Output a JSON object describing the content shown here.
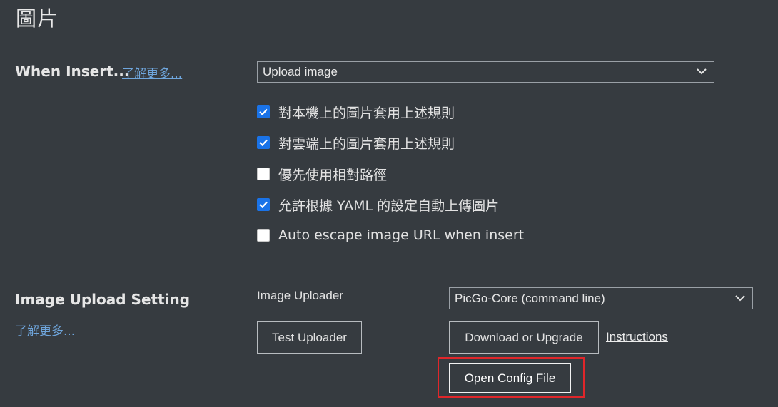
{
  "page": {
    "title": "圖片"
  },
  "when_insert": {
    "label": "When Insert...",
    "learn_more": "了解更多...",
    "select_value": "Upload image",
    "options": [
      {
        "label": "對本機上的圖片套用上述規則",
        "checked": true
      },
      {
        "label": "對雲端上的圖片套用上述規則",
        "checked": true
      },
      {
        "label": "優先使用相對路徑",
        "checked": false
      },
      {
        "label": "允許根據 YAML 的設定自動上傳圖片",
        "checked": true
      },
      {
        "label": "Auto escape image URL when insert",
        "checked": false
      }
    ]
  },
  "upload_setting": {
    "label": "Image Upload Setting",
    "learn_more": "了解更多...",
    "uploader_label": "Image Uploader",
    "uploader_value": "PicGo-Core (command line)",
    "test_button": "Test Uploader",
    "download_button": "Download or Upgrade",
    "instructions_link": "Instructions",
    "open_config_button": "Open Config File"
  },
  "colors": {
    "background": "#363b40",
    "checkbox_accent": "#1a73e8",
    "link": "#6fa6dd",
    "highlight": "#e0262a"
  },
  "icons": {
    "select_arrow": "chevron-down-icon",
    "check": "checkmark-icon"
  }
}
